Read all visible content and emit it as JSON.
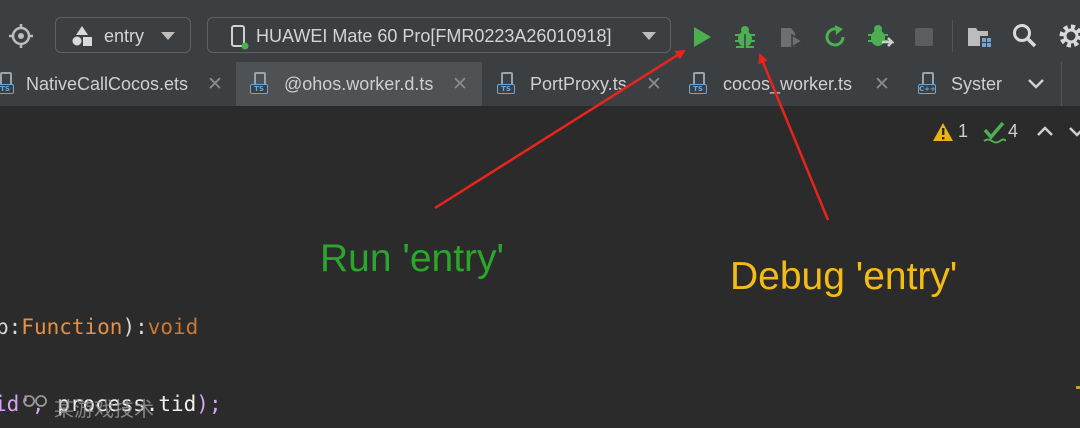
{
  "toolbar": {
    "module_combo": {
      "value": "entry",
      "icon": "module-icon"
    },
    "device_combo": {
      "value": "HUAWEI Mate 60 Pro[FMR0223A26010918]",
      "icon": "phone-icon"
    },
    "buttons": [
      "target-icon",
      "run-icon",
      "debug-icon",
      "profile-icon",
      "rerun-icon",
      "attach-debugger-icon",
      "stop-icon",
      "project-structure-icon",
      "search-icon",
      "settings-icon"
    ]
  },
  "tabs": [
    {
      "label": "NativeCallCocos.ets",
      "file_type": "TS"
    },
    {
      "label": "@ohos.worker.d.ts",
      "file_type": "TS"
    },
    {
      "label": "PortProxy.ts",
      "file_type": "TS"
    },
    {
      "label": "cocos_worker.ts",
      "file_type": "TS"
    },
    {
      "label": "Syster",
      "file_type": "C++"
    }
  ],
  "inspections": {
    "warnings": "1",
    "weak_warnings": "4"
  },
  "code": {
    "line1": {
      "part1": "b:",
      "type": "Function",
      "part2": "):",
      "kw": "void"
    },
    "line2": {
      "part1": "id', ",
      "part2": "process.tid",
      "part3": ");"
    }
  },
  "annotations": {
    "run": "Run 'entry'",
    "debug": "Debug 'entry'"
  },
  "watermark": "某游戏技术",
  "colors": {
    "run_green": "#4caf50",
    "annotation_green": "#2aa72a",
    "annotation_yellow": "#f5bb15",
    "arrow_red": "#e8241c"
  }
}
